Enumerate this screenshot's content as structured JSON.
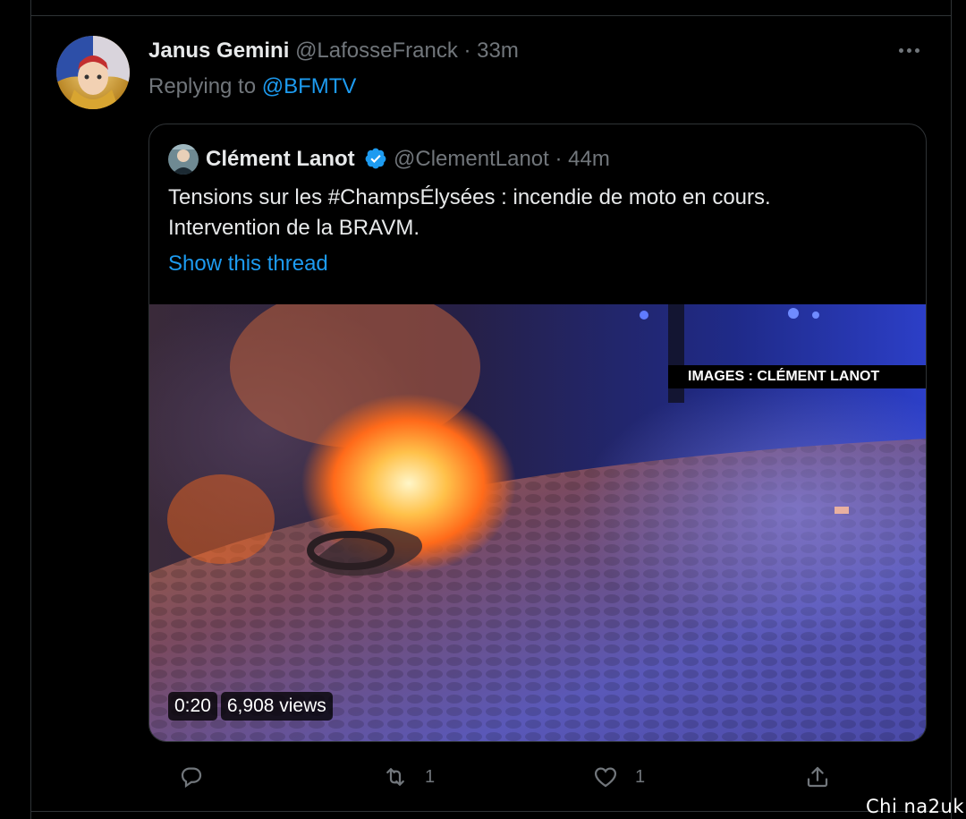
{
  "tweet": {
    "author_name": "Janus Gemini",
    "author_meta": "@LafosseFranck · 33m",
    "replying_prefix": "Replying to",
    "replying_handle": "@BFMTV"
  },
  "quoted_tweet": {
    "author_name": "Clément Lanot",
    "author_meta": "@ClementLanot · 44m",
    "text_line1": "Tensions sur les #ChampsÉlysées : incendie de moto en cours.",
    "text_line2": "Intervention de la BRAVM.",
    "show_thread": "Show this thread",
    "media": {
      "banner": "IMAGES : CLÉMENT LANOT",
      "duration": "0:20",
      "views": "6,908 views"
    }
  },
  "actions": {
    "reply_count": "",
    "retweet_count": "1",
    "like_count": "1"
  },
  "watermark": "Chi na2uk",
  "colors": {
    "background": "#000000",
    "text": "#e7e9ea",
    "muted": "#71767b",
    "link": "#1d9bf0",
    "border": "#2f3336"
  },
  "icons": [
    "more-icon",
    "verified-icon",
    "reply-icon",
    "retweet-icon",
    "like-icon",
    "share-icon"
  ]
}
